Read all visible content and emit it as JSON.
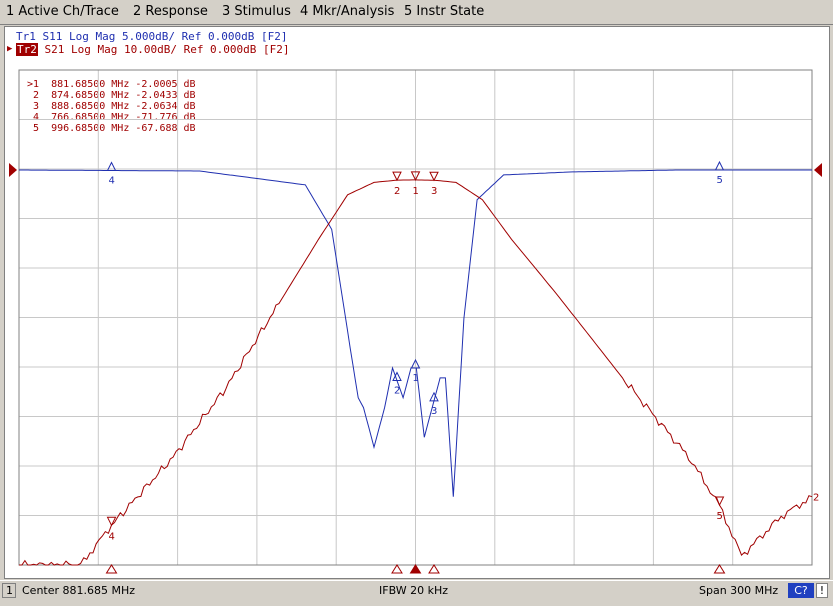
{
  "menu": [
    {
      "label": "1 Active Ch/Trace"
    },
    {
      "label": "2 Response"
    },
    {
      "label": "3 Stimulus"
    },
    {
      "label": "4 Mkr/Analysis"
    },
    {
      "label": "5 Instr State"
    }
  ],
  "traces": {
    "tr1": "Tr1 S11 Log Mag 5.000dB/ Ref 0.000dB [F2]",
    "tr2_tag": "Tr2",
    "tr2": " S21 Log Mag 10.00dB/ Ref 0.000dB [F2]"
  },
  "marker_table": [
    ">1  881.68500 MHz -2.0005 dB",
    " 2  874.68500 MHz -2.0433 dB",
    " 3  888.68500 MHz -2.0634 dB",
    " 4  766.68500 MHz -71.776 dB",
    " 5  996.68500 MHz -67.688 dB"
  ],
  "markers": {
    "s21": [
      {
        "label": "1",
        "freq_mhz": 881.685,
        "db": -2.0005
      },
      {
        "label": "2",
        "freq_mhz": 874.685,
        "db": -2.0433
      },
      {
        "label": "3",
        "freq_mhz": 888.685,
        "db": -2.0634
      },
      {
        "label": "4",
        "freq_mhz": 766.685,
        "db": -71.776
      },
      {
        "label": "5",
        "freq_mhz": 996.685,
        "db": -67.688
      }
    ]
  },
  "status": {
    "channel": "1",
    "center": "Center 881.685 MHz",
    "ifbw": "IFBW 20 kHz",
    "span": "Span 300 MHz",
    "cal": "C?",
    "alert": "!"
  },
  "colors": {
    "trace1": "#1f2fb0",
    "trace2": "#a00000",
    "grid": "#c8c8c8"
  },
  "chart_data": {
    "type": "line",
    "x_unit": "MHz",
    "xlim": [
      731.685,
      1031.685
    ],
    "series": [
      {
        "name": "Tr1 S11",
        "scale_db_per_div": 5,
        "ref_db": 0,
        "x": [
          731.685,
          800,
          840,
          850,
          857,
          860,
          862,
          866,
          870,
          873,
          877,
          880,
          882,
          885,
          888,
          891,
          893,
          896,
          900,
          905,
          915,
          940,
          980,
          1031.685
        ],
        "y": [
          0,
          -0.1,
          -1.5,
          -6,
          -18,
          -23,
          -24,
          -28,
          -24,
          -20,
          -23,
          -20,
          -20,
          -27,
          -24,
          -21,
          -21,
          -33,
          -15,
          -3,
          -0.5,
          -0.2,
          0,
          0
        ]
      },
      {
        "name": "Tr2 S21",
        "scale_db_per_div": 10,
        "ref_db": 0,
        "x": [
          731.685,
          755,
          766.685,
          790,
          810,
          830,
          845,
          856,
          866,
          874.685,
          881.685,
          888.685,
          897,
          907,
          918,
          935,
          960,
          985,
          996.685,
          1005,
          1020,
          1031.685
        ],
        "y": [
          -80,
          -80,
          -71.776,
          -58,
          -44,
          -27,
          -14,
          -5,
          -2.5,
          -2.0433,
          -2.0005,
          -2.0634,
          -2.5,
          -6,
          -14,
          -25,
          -42,
          -58,
          -67.688,
          -78,
          -70,
          -66
        ]
      }
    ]
  }
}
